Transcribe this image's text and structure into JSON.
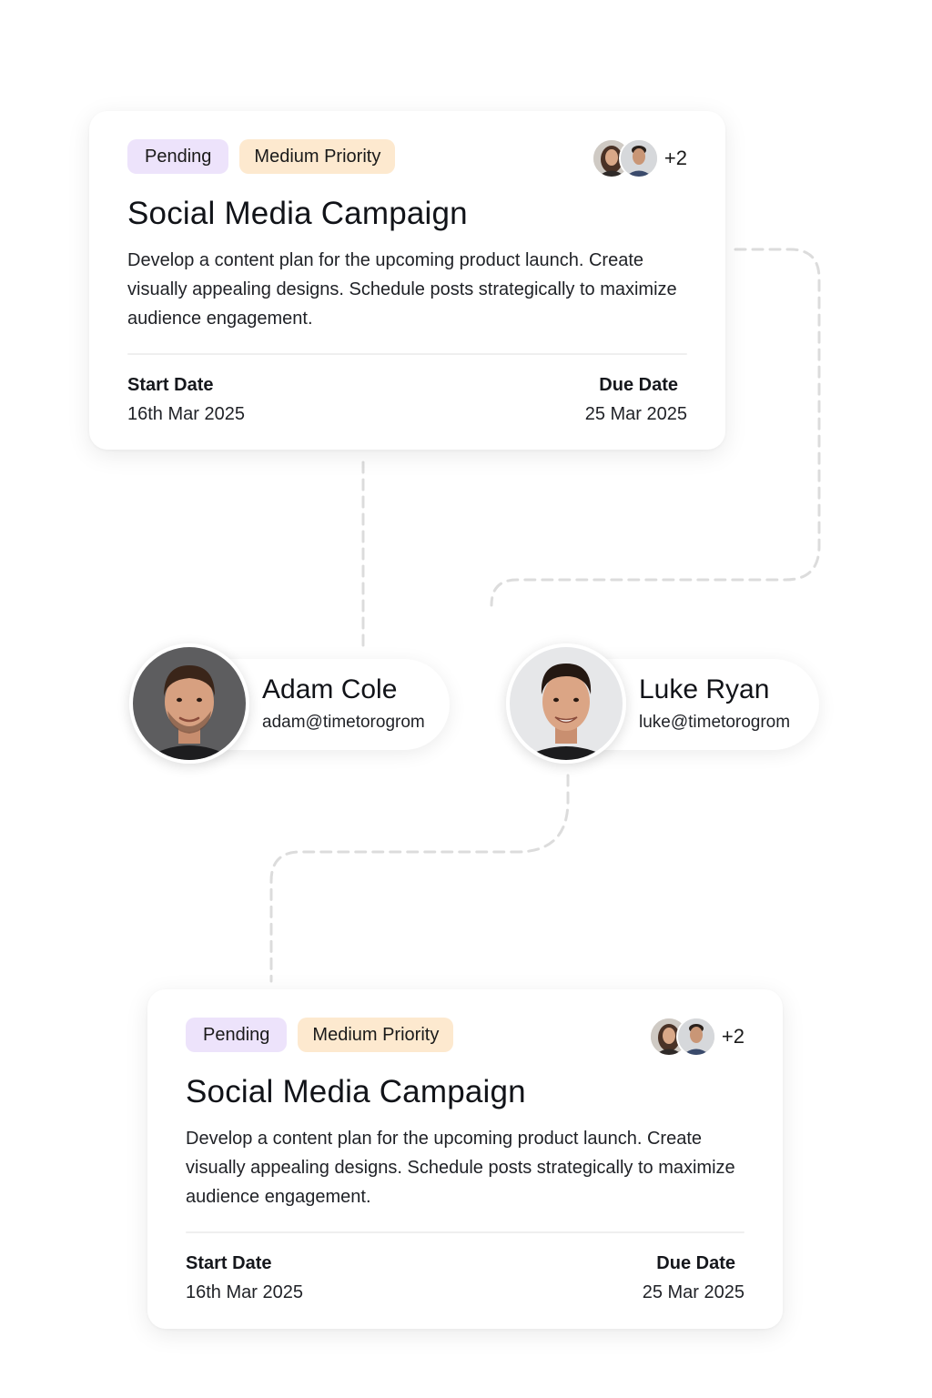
{
  "tasks": [
    {
      "status": "Pending",
      "priority": "Medium Priority",
      "extra_assignees": "+2",
      "title": "Social Media Campaign",
      "description": "Develop a content plan for the upcoming product launch. Create visually appealing designs. Schedule posts strategically to maximize audience engagement.",
      "start_label": "Start Date",
      "start_value": "16th Mar 2025",
      "due_label": "Due Date",
      "due_value": "25 Mar 2025"
    },
    {
      "status": "Pending",
      "priority": "Medium Priority",
      "extra_assignees": "+2",
      "title": "Social Media Campaign",
      "description": "Develop a content plan for the upcoming product launch. Create visually appealing designs. Schedule posts strategically to maximize audience engagement.",
      "start_label": "Start Date",
      "start_value": "16th Mar 2025",
      "due_label": "Due Date",
      "due_value": "25 Mar 2025"
    }
  ],
  "people": [
    {
      "name": "Adam Cole",
      "email": "adam@timetorogrom"
    },
    {
      "name": "Luke Ryan",
      "email": "luke@timetorogrom"
    }
  ],
  "colors": {
    "status_badge_bg": "#ede3fb",
    "priority_badge_bg": "#fde9cf",
    "connector": "#dcdcdc"
  }
}
